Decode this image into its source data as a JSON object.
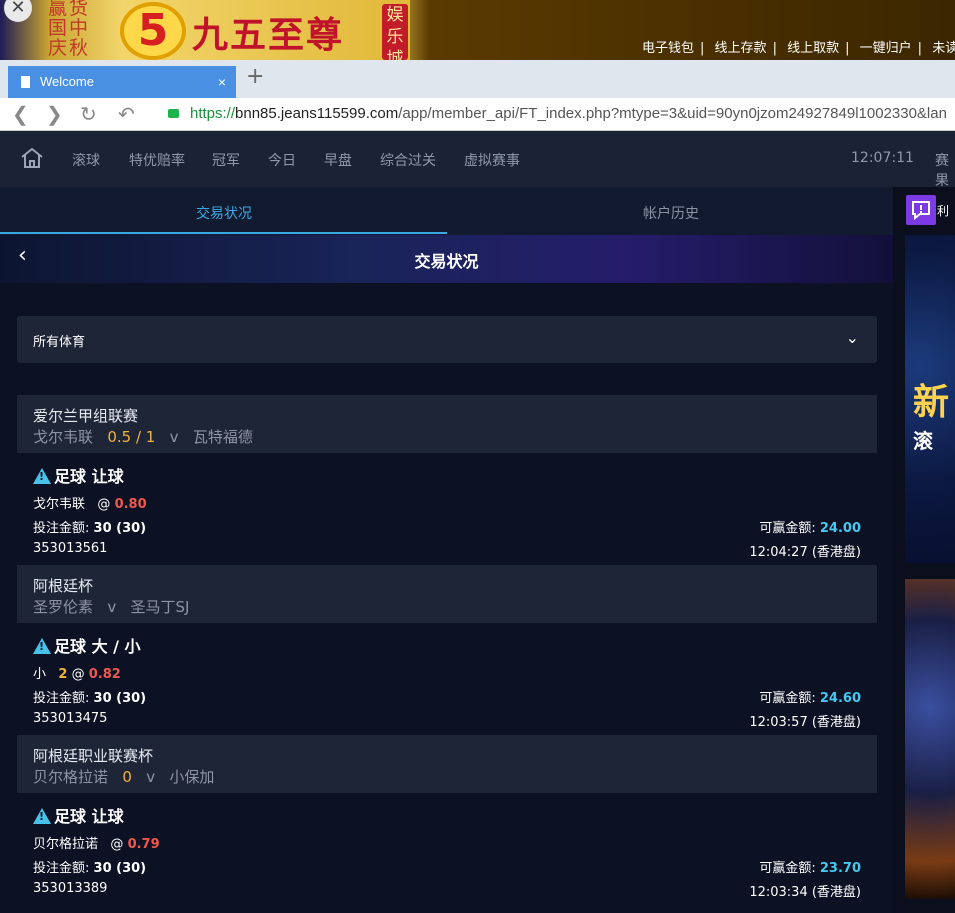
{
  "banner": {
    "left_text": "赢货国中庆秋",
    "five_mark": "5",
    "brand": "九五至尊",
    "brand_tag": "娱乐城",
    "links": [
      "电子钱包",
      "线上存款",
      "线上取款",
      "一键归户",
      "未读讯"
    ],
    "close_glyph": "✕"
  },
  "browser": {
    "tab_title": "Welcome",
    "tab_close": "×",
    "new_tab": "+",
    "url_scheme": "https://",
    "url_host": "bnn85.jeans115599.com",
    "url_path": "/app/member_api/FT_index.php?mtype=3&uid=90yn0jzom24927849l1002330&lan",
    "nav_icons": [
      "back-icon",
      "forward-icon",
      "reload-icon",
      "undo-icon"
    ]
  },
  "topnav": {
    "items": [
      "滚球",
      "特优赔率",
      "冠军",
      "今日",
      "早盘",
      "综合过关",
      "虚拟赛事"
    ],
    "clock": "12:07:11",
    "right_label": "赛果"
  },
  "subtabs": {
    "active": "交易状况",
    "other": "帐户历史"
  },
  "hero": {
    "title": "交易状况",
    "back_glyph": "‹"
  },
  "filter": {
    "label": "所有体育",
    "chevron": "⌄"
  },
  "bets": [
    {
      "league": "爱尔兰甲组联赛",
      "home": "戈尔韦联",
      "handicap": "0.5 / 1",
      "vs": "v",
      "away": "瓦特福德",
      "type": "足球 让球",
      "pick": "戈尔韦联",
      "pick_line": "",
      "at": "@",
      "odds": "0.80",
      "stake_label": "投注金额:",
      "stake": "30 (30)",
      "win_label": "可赢金额:",
      "win": "24.00",
      "ticket": "353013561",
      "time": "12:04:27 (香港盘)"
    },
    {
      "league": "阿根廷杯",
      "home": "圣罗伦素",
      "handicap": "",
      "vs": "v",
      "away": "圣马丁SJ",
      "type": "足球 大 / 小",
      "pick": "小",
      "pick_line": "2",
      "at": "@",
      "odds": "0.82",
      "stake_label": "投注金额:",
      "stake": "30 (30)",
      "win_label": "可赢金额:",
      "win": "24.60",
      "ticket": "353013475",
      "time": "12:03:57 (香港盘)"
    },
    {
      "league": "阿根廷职业联赛杯",
      "home": "贝尔格拉诺",
      "handicap": "0",
      "vs": "v",
      "away": "小保加",
      "type": "足球 让球",
      "pick": "贝尔格拉诺",
      "pick_line": "",
      "at": "@",
      "odds": "0.79",
      "stake_label": "投注金额:",
      "stake": "30 (30)",
      "win_label": "可赢金额:",
      "win": "23.70",
      "ticket": "353013389",
      "time": "12:03:34 (香港盘)"
    }
  ],
  "side": {
    "chat_label": "利",
    "ad_text1": "新",
    "ad_text2": "滚"
  }
}
